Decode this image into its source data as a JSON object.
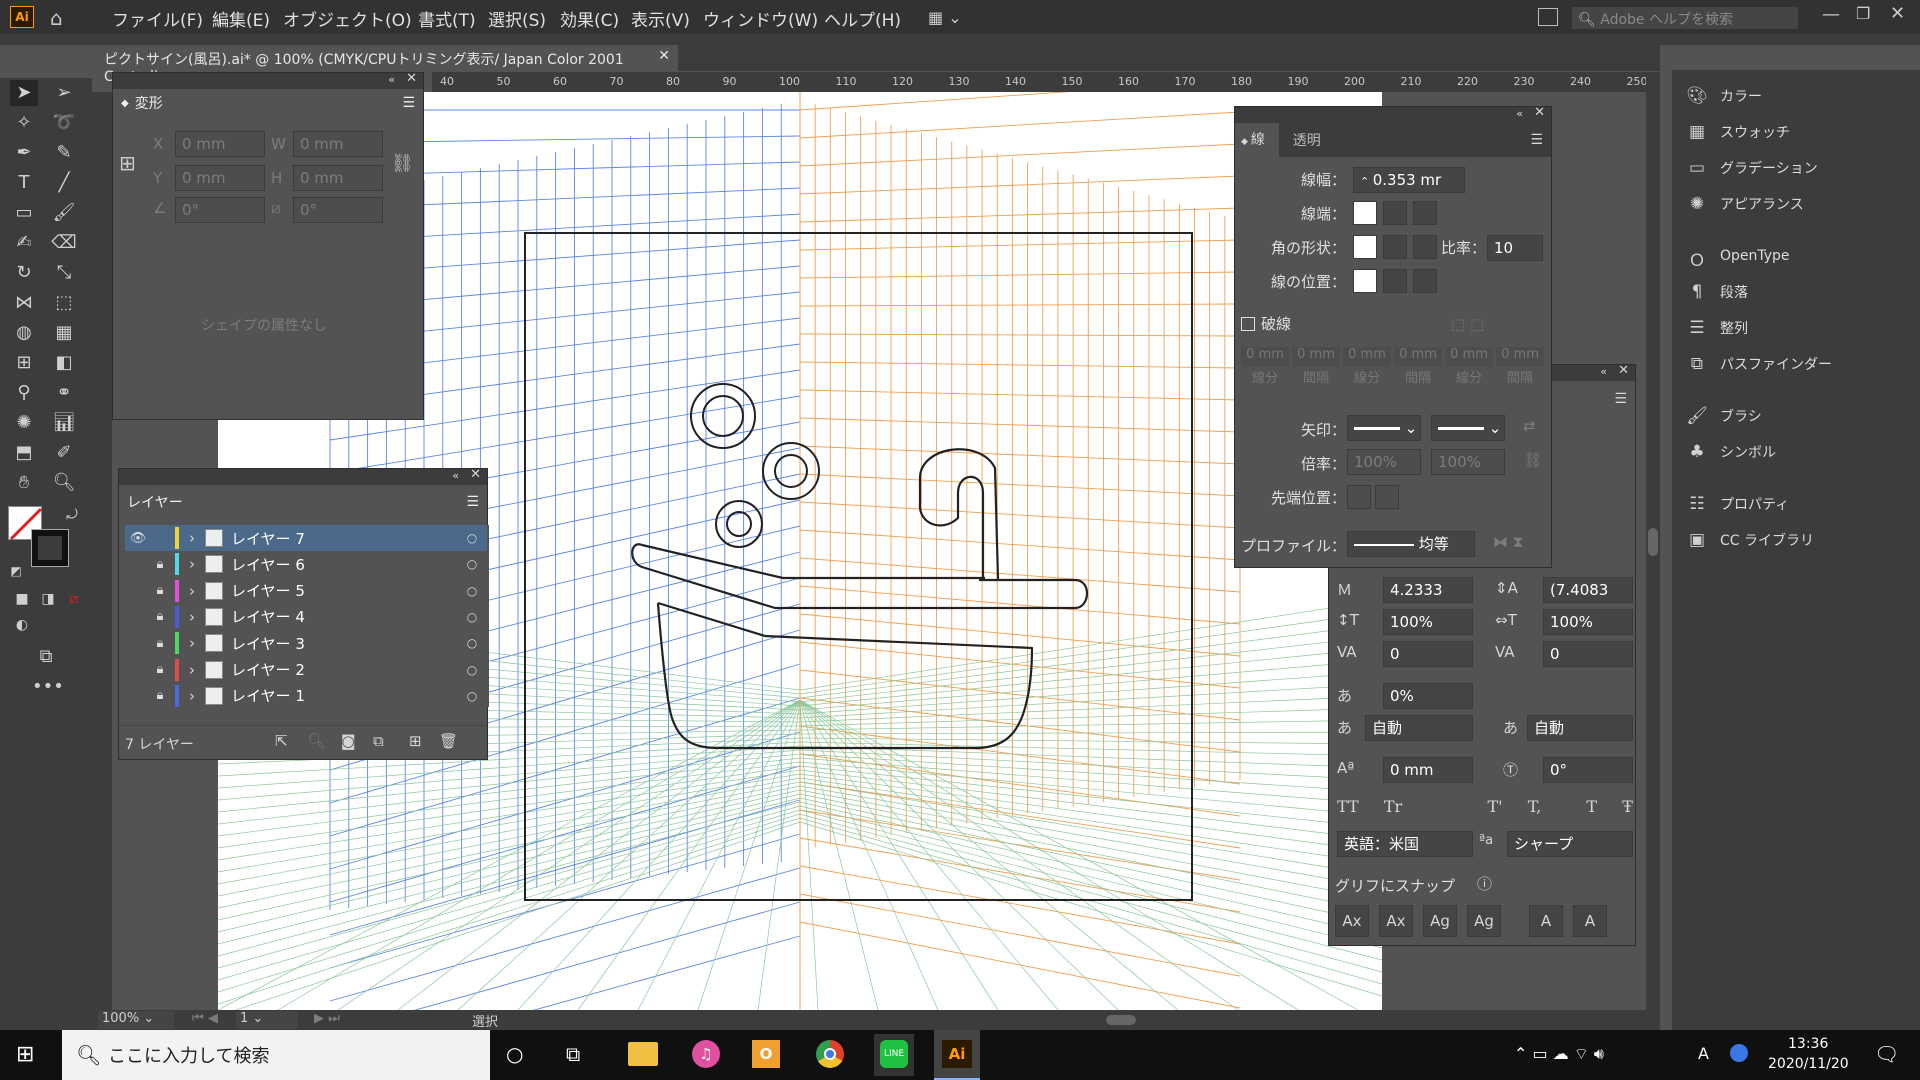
{
  "app": {
    "logo": "Ai",
    "menu": [
      "ファイル(F)",
      "編集(E)",
      "オブジェクト(O)",
      "書式(T)",
      "選択(S)",
      "効果(C)",
      "表示(V)",
      "ウィンドウ(W)",
      "ヘルプ(H)"
    ],
    "help_search_placeholder": "Adobe ヘルプを検索"
  },
  "document": {
    "tab_title": "ピクトサイン(風呂).ai* @ 100% (CMYK/CPUトリミング表示/ Japan Color 2001 Coated)",
    "close": "✕"
  },
  "ruler": {
    "top": [
      "40",
      "50",
      "60",
      "70",
      "80",
      "90",
      "100",
      "110",
      "120",
      "130",
      "140",
      "150",
      "160",
      "170",
      "180",
      "190",
      "200",
      "210",
      "220",
      "230",
      "240",
      "250"
    ]
  },
  "transform_panel": {
    "title": "変形",
    "x_label": "X",
    "y_label": "Y",
    "w_label": "W",
    "h_label": "H",
    "x": "0 mm",
    "y": "0 mm",
    "w": "0 mm",
    "h": "0 mm",
    "angle": "0°",
    "shear": "0°",
    "no_shape": "シェイプの属性なし"
  },
  "layers_panel": {
    "title": "レイヤー",
    "count": "7 レイヤー",
    "layers": [
      {
        "name": "レイヤー 7",
        "color": "#f0d33b"
      },
      {
        "name": "レイヤー 6",
        "color": "#4fd8e8"
      },
      {
        "name": "レイヤー 5",
        "color": "#e052d9"
      },
      {
        "name": "レイヤー 4",
        "color": "#4a5bd9"
      },
      {
        "name": "レイヤー 3",
        "color": "#4fd86a"
      },
      {
        "name": "レイヤー 2",
        "color": "#e04c4c"
      },
      {
        "name": "レイヤー 1",
        "color": "#4a6bd9"
      }
    ]
  },
  "stroke_panel": {
    "tab_stroke": "線",
    "tab_transparency": "透明",
    "weight_label": "線幅：",
    "weight": "0.353 mr",
    "cap_label": "線端：",
    "corner_label": "角の形状：",
    "limit_label": "比率：",
    "limit": "10",
    "align_label": "線の位置：",
    "dashed_label": "破線",
    "dash_values": [
      "0 mm",
      "0 mm",
      "0 mm",
      "0 mm",
      "0 mm",
      "0 mm"
    ],
    "dash_labels": [
      "線分",
      "間隔",
      "線分",
      "間隔",
      "線分",
      "間隔"
    ],
    "arrow_label": "矢印：",
    "scale_label": "倍率：",
    "scale1": "100%",
    "scale2": "100%",
    "tip_label": "先端位置：",
    "profile_label": "プロファイル：",
    "profile": "均等"
  },
  "char_panel": {
    "kerning": "4.2333",
    "leading": "(7.4083",
    "vscale": "100%",
    "hscale": "100%",
    "tracking": "0",
    "tracking2": "0",
    "tsume": "0%",
    "aki_before": "自動",
    "aki_after": "自動",
    "baseline": "0 mm",
    "rotation": "0°",
    "language": "英語：米国",
    "antialias": "シャープ",
    "snap": "グリフにスナップ",
    "tt_buttons": [
      "TT",
      "Tr",
      "T'",
      "T,",
      "T",
      "Ŧ"
    ],
    "snap_buttons": [
      "Ax",
      "Ax",
      "Ag",
      "Ag",
      "A",
      "A"
    ]
  },
  "right_panels": [
    "カラー",
    "スウォッチ",
    "グラデーション",
    "アピアランス",
    "OpenType",
    "段落",
    "整列",
    "パスファインダー",
    "ブラシ",
    "シンボル",
    "プロパティ",
    "CC ライブラリ"
  ],
  "status": {
    "zoom": "100%",
    "page": "1",
    "mode": "選択"
  },
  "taskbar": {
    "search": "ここに入力して検索",
    "time": "13:36",
    "date": "2020/11/20",
    "ai_label": "Ai",
    "ime": "A"
  }
}
